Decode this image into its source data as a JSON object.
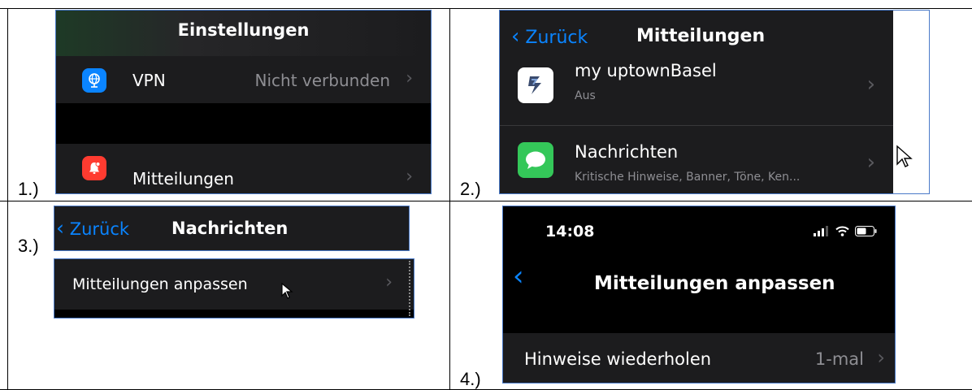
{
  "panel1": {
    "step": "1.)",
    "title": "Einstellungen",
    "rows": [
      {
        "label": "VPN",
        "value": "Nicht verbunden",
        "icon": "globe-icon",
        "color": "#0a84ff"
      },
      {
        "label": "Mitteilungen",
        "icon": "notification-bell-icon",
        "color": "#ff3b30"
      }
    ]
  },
  "panel2": {
    "step": "2.)",
    "back": "Zurück",
    "title": "Mitteilungen",
    "rows": [
      {
        "label": "my uptownBasel",
        "sub": "Aus",
        "icon": "uptownbasel-app-icon"
      },
      {
        "label": "Nachrichten",
        "sub": "Kritische Hinweise, Banner, Töne, Ken...",
        "icon": "messages-app-icon",
        "color": "#34c759"
      }
    ]
  },
  "panel3": {
    "step": "3.)",
    "back": "Zurück",
    "title": "Nachrichten",
    "row_label": "Mitteilungen anpassen"
  },
  "panel4": {
    "step": "4.)",
    "time": "14:08",
    "title": "Mitteilungen anpassen",
    "row_label": "Hinweise wiederholen",
    "row_value": "1-mal"
  },
  "colors": {
    "accent": "#0a84ff",
    "background": "#1c1c1e",
    "border": "#4a7ac8"
  }
}
